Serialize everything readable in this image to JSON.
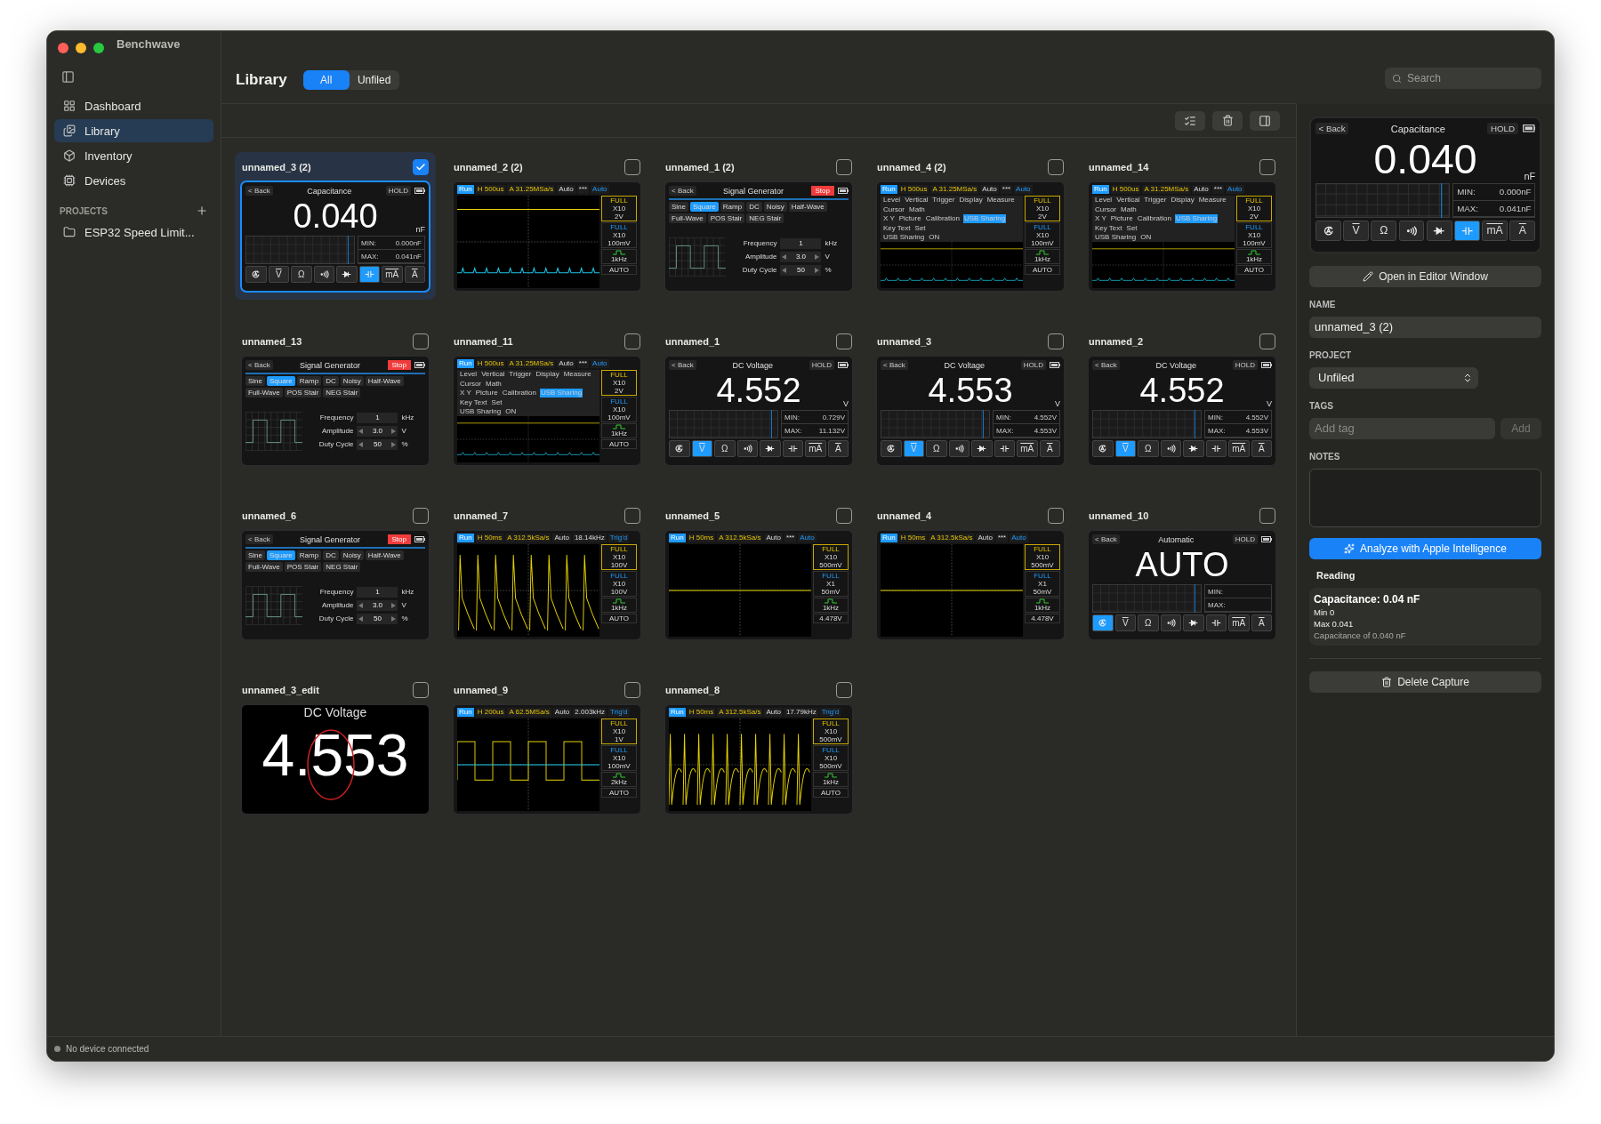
{
  "window": {
    "title": "Benchwave"
  },
  "sidebar": {
    "items": [
      {
        "label": "Dashboard",
        "selected": false
      },
      {
        "label": "Library",
        "selected": true
      },
      {
        "label": "Inventory",
        "selected": false
      },
      {
        "label": "Devices",
        "selected": false
      }
    ],
    "projects_heading": "PROJECTS",
    "projects": [
      {
        "label": "ESP32 Speed Limit..."
      }
    ]
  },
  "header": {
    "title": "Library",
    "filters": [
      {
        "label": "All",
        "selected": true
      },
      {
        "label": "Unfiled",
        "selected": false
      }
    ],
    "search": {
      "placeholder": "Search"
    }
  },
  "captures": [
    {
      "name": "unnamed_3 (2)",
      "selected": true,
      "screen": {
        "kind": "meter",
        "back": "< Back",
        "title": "Capacitance",
        "hold": "HOLD",
        "value": "0.040",
        "unit": "nF",
        "min_label": "MIN:",
        "min": "0.000nF",
        "max_label": "MAX:",
        "max": "0.041nF",
        "modes": [
          {
            "kind": "auto",
            "selected": false
          },
          {
            "kind": "dc",
            "label": "V",
            "selected": false
          },
          {
            "kind": "text",
            "label": "Ω",
            "selected": false
          },
          {
            "kind": "continuity",
            "selected": false
          },
          {
            "kind": "diode",
            "selected": false
          },
          {
            "kind": "cap",
            "selected": true
          },
          {
            "kind": "dc",
            "label": "mA",
            "selected": false
          },
          {
            "kind": "dc",
            "label": "A",
            "selected": false
          }
        ]
      }
    },
    {
      "name": "unnamed_2 (2)",
      "selected": false,
      "screen": {
        "kind": "scope",
        "run": "Run",
        "timebase": "H 500us",
        "rate": "A 31.25MSa/s",
        "trig": "Auto",
        "f_value": "***",
        "status": "Auto",
        "ch1": {
          "label": "FULL",
          "probe": "X10",
          "scale": "2V"
        },
        "ch2": {
          "label": "FULL",
          "probe": "X10",
          "scale": "100mV"
        },
        "fn": "1kHz",
        "mode": "AUTO",
        "trace": {
          "kind": "flat-high"
        }
      }
    },
    {
      "name": "unnamed_1 (2)",
      "selected": false,
      "screen": {
        "kind": "siggen",
        "back": "< Back",
        "title": "Signal Generator",
        "stop": "Stop",
        "waves": [
          {
            "label": "Sine",
            "selected": false
          },
          {
            "label": "Square",
            "selected": true
          },
          {
            "label": "Ramp",
            "selected": false
          },
          {
            "label": "DC",
            "selected": false
          },
          {
            "label": "Noisy",
            "selected": false
          },
          {
            "label": "Half-Wave",
            "selected": false
          },
          {
            "label": "Full-Wave",
            "selected": false
          },
          {
            "label": "POS Stair",
            "selected": false
          },
          {
            "label": "NEG Stair",
            "selected": false
          }
        ],
        "params": [
          {
            "label": "Frequency",
            "value": "1",
            "unit": "kHz",
            "stepper": false
          },
          {
            "label": "Amplitude",
            "value": "3.0",
            "unit": "V",
            "stepper": true
          },
          {
            "label": "Duty Cycle",
            "value": "50",
            "unit": "%",
            "stepper": true
          }
        ]
      }
    },
    {
      "name": "unnamed_4 (2)",
      "selected": false,
      "screen": {
        "kind": "scope",
        "run": "Run",
        "timebase": "H 500us",
        "rate": "A 31.25MSa/s",
        "trig": "Auto",
        "f_value": "***",
        "status": "Auto",
        "ch1": {
          "label": "FULL",
          "probe": "X10",
          "scale": "2V"
        },
        "ch2": {
          "label": "FULL",
          "probe": "X10",
          "scale": "100mV"
        },
        "fn": "1kHz",
        "mode": "AUTO",
        "trace": {
          "kind": "flat-high"
        },
        "menu": {
          "tabs": [
            "Level",
            "Vertical",
            "Trigger",
            "Display",
            "Measure",
            "Cursor",
            "Math"
          ],
          "options": [
            {
              "label": "X Y",
              "selected": false
            },
            {
              "label": "Picture",
              "selected": false
            },
            {
              "label": "Calibration",
              "selected": false
            },
            {
              "label": "USB Sharing",
              "selected": true
            },
            {
              "label": "Key Text",
              "selected": false
            },
            {
              "label": "Set",
              "selected": false
            }
          ],
          "setting": "USB Sharing",
          "setting_value": "ON"
        }
      }
    },
    {
      "name": "unnamed_14",
      "selected": false,
      "screen": {
        "kind": "scope",
        "run": "Run",
        "timebase": "H 500us",
        "rate": "A 31.25MSa/s",
        "trig": "Auto",
        "f_value": "***",
        "status": "Auto",
        "ch1": {
          "label": "FULL",
          "probe": "X10",
          "scale": "2V"
        },
        "ch2": {
          "label": "FULL",
          "probe": "X10",
          "scale": "100mV"
        },
        "fn": "1kHz",
        "mode": "AUTO",
        "trace": {
          "kind": "flat-high"
        },
        "menu": {
          "tabs": [
            "Level",
            "Vertical",
            "Trigger",
            "Display",
            "Measure",
            "Cursor",
            "Math"
          ],
          "options": [
            {
              "label": "X Y",
              "selected": false
            },
            {
              "label": "Picture",
              "selected": false
            },
            {
              "label": "Calibration",
              "selected": false
            },
            {
              "label": "USB Sharing",
              "selected": true
            },
            {
              "label": "Key Text",
              "selected": false
            },
            {
              "label": "Set",
              "selected": false
            }
          ],
          "setting": "USB Sharing",
          "setting_value": "ON"
        }
      }
    },
    {
      "name": "unnamed_13",
      "selected": false,
      "screen": {
        "kind": "siggen",
        "back": "< Back",
        "title": "Signal Generator",
        "stop": "Stop",
        "waves": [
          {
            "label": "Sine",
            "selected": false
          },
          {
            "label": "Square",
            "selected": true
          },
          {
            "label": "Ramp",
            "selected": false
          },
          {
            "label": "DC",
            "selected": false
          },
          {
            "label": "Noisy",
            "selected": false
          },
          {
            "label": "Half-Wave",
            "selected": false
          },
          {
            "label": "Full-Wave",
            "selected": false
          },
          {
            "label": "POS Stair",
            "selected": false
          },
          {
            "label": "NEG Stair",
            "selected": false
          }
        ],
        "params": [
          {
            "label": "Frequency",
            "value": "1",
            "unit": "kHz",
            "stepper": false
          },
          {
            "label": "Amplitude",
            "value": "3.0",
            "unit": "V",
            "stepper": true
          },
          {
            "label": "Duty Cycle",
            "value": "50",
            "unit": "%",
            "stepper": true
          }
        ]
      }
    },
    {
      "name": "unnamed_11",
      "selected": false,
      "screen": {
        "kind": "scope",
        "run": "Run",
        "timebase": "H 500us",
        "rate": "A 31.25MSa/s",
        "trig": "Auto",
        "f_value": "***",
        "status": "Auto",
        "ch1": {
          "label": "FULL",
          "probe": "X10",
          "scale": "2V"
        },
        "ch2": {
          "label": "FULL",
          "probe": "X10",
          "scale": "100mV"
        },
        "fn": "1kHz",
        "mode": "AUTO",
        "trace": {
          "kind": "flat-high"
        },
        "menu": {
          "tabs": [
            "Level",
            "Vertical",
            "Trigger",
            "Display",
            "Measure",
            "Cursor",
            "Math"
          ],
          "options": [
            {
              "label": "X Y",
              "selected": false
            },
            {
              "label": "Picture",
              "selected": false
            },
            {
              "label": "Calibration",
              "selected": false
            },
            {
              "label": "USB Sharing",
              "selected": true
            },
            {
              "label": "Key Text",
              "selected": false
            },
            {
              "label": "Set",
              "selected": false
            }
          ],
          "setting": "USB Sharing",
          "setting_value": "ON"
        }
      }
    },
    {
      "name": "unnamed_1",
      "selected": false,
      "screen": {
        "kind": "meter",
        "back": "< Back",
        "title": "DC Voltage",
        "hold": "HOLD",
        "value": "4.552",
        "unit": "V",
        "min_label": "MIN:",
        "min": "0.729V",
        "max_label": "MAX:",
        "max": "11.132V",
        "modes": [
          {
            "kind": "auto",
            "selected": false
          },
          {
            "kind": "dc",
            "label": "V",
            "selected": true
          },
          {
            "kind": "text",
            "label": "Ω",
            "selected": false
          },
          {
            "kind": "continuity",
            "selected": false
          },
          {
            "kind": "diode",
            "selected": false
          },
          {
            "kind": "cap",
            "selected": false
          },
          {
            "kind": "dc",
            "label": "mA",
            "selected": false
          },
          {
            "kind": "dc",
            "label": "A",
            "selected": false
          }
        ]
      }
    },
    {
      "name": "unnamed_3",
      "selected": false,
      "screen": {
        "kind": "meter",
        "back": "< Back",
        "title": "DC Voltage",
        "hold": "HOLD",
        "value": "4.553",
        "unit": "V",
        "min_label": "MIN:",
        "min": "4.552V",
        "max_label": "MAX:",
        "max": "4.553V",
        "modes": [
          {
            "kind": "auto",
            "selected": false
          },
          {
            "kind": "dc",
            "label": "V",
            "selected": true
          },
          {
            "kind": "text",
            "label": "Ω",
            "selected": false
          },
          {
            "kind": "continuity",
            "selected": false
          },
          {
            "kind": "diode",
            "selected": false
          },
          {
            "kind": "cap",
            "selected": false
          },
          {
            "kind": "dc",
            "label": "mA",
            "selected": false
          },
          {
            "kind": "dc",
            "label": "A",
            "selected": false
          }
        ]
      }
    },
    {
      "name": "unnamed_2",
      "selected": false,
      "screen": {
        "kind": "meter",
        "back": "< Back",
        "title": "DC Voltage",
        "hold": "HOLD",
        "value": "4.552",
        "unit": "V",
        "min_label": "MIN:",
        "min": "4.552V",
        "max_label": "MAX:",
        "max": "4.553V",
        "modes": [
          {
            "kind": "auto",
            "selected": false
          },
          {
            "kind": "dc",
            "label": "V",
            "selected": true
          },
          {
            "kind": "text",
            "label": "Ω",
            "selected": false
          },
          {
            "kind": "continuity",
            "selected": false
          },
          {
            "kind": "diode",
            "selected": false
          },
          {
            "kind": "cap",
            "selected": false
          },
          {
            "kind": "dc",
            "label": "mA",
            "selected": false
          },
          {
            "kind": "dc",
            "label": "A",
            "selected": false
          }
        ]
      }
    },
    {
      "name": "unnamed_6",
      "selected": false,
      "screen": {
        "kind": "siggen",
        "back": "< Back",
        "title": "Signal Generator",
        "stop": "Stop",
        "waves": [
          {
            "label": "Sine",
            "selected": false
          },
          {
            "label": "Square",
            "selected": true
          },
          {
            "label": "Ramp",
            "selected": false
          },
          {
            "label": "DC",
            "selected": false
          },
          {
            "label": "Noisy",
            "selected": false
          },
          {
            "label": "Half-Wave",
            "selected": false
          },
          {
            "label": "Full-Wave",
            "selected": false
          },
          {
            "label": "POS Stair",
            "selected": false
          },
          {
            "label": "NEG Stair",
            "selected": false
          }
        ],
        "params": [
          {
            "label": "Frequency",
            "value": "1",
            "unit": "kHz",
            "stepper": false
          },
          {
            "label": "Amplitude",
            "value": "3.0",
            "unit": "V",
            "stepper": true
          },
          {
            "label": "Duty Cycle",
            "value": "50",
            "unit": "%",
            "stepper": true
          }
        ]
      }
    },
    {
      "name": "unnamed_7",
      "selected": false,
      "screen": {
        "kind": "scope",
        "run": "Run",
        "timebase": "H 50ms",
        "rate": "A 312.5kSa/s",
        "trig": "Auto",
        "f_value": "18.14kHz",
        "status": "Trig'd",
        "ch1": {
          "label": "FULL",
          "probe": "X10",
          "scale": "100V"
        },
        "ch2": {
          "label": "FULL",
          "probe": "X10",
          "scale": "100V"
        },
        "fn": "1kHz",
        "mode": "AUTO",
        "trace": {
          "kind": "pulses"
        }
      }
    },
    {
      "name": "unnamed_5",
      "selected": false,
      "screen": {
        "kind": "scope",
        "run": "Run",
        "timebase": "H 50ms",
        "rate": "A 312.5kSa/s",
        "trig": "Auto",
        "f_value": "***",
        "status": "Auto",
        "ch1": {
          "label": "FULL",
          "probe": "X10",
          "scale": "500mV"
        },
        "ch2": {
          "label": "FULL",
          "probe": "X1",
          "scale": "50mV"
        },
        "fn": "1kHz",
        "mode": "4.478V",
        "trace": {
          "kind": "flat-mid"
        }
      }
    },
    {
      "name": "unnamed_4",
      "selected": false,
      "screen": {
        "kind": "scope",
        "run": "Run",
        "timebase": "H 50ms",
        "rate": "A 312.5kSa/s",
        "trig": "Auto",
        "f_value": "***",
        "status": "Auto",
        "ch1": {
          "label": "FULL",
          "probe": "X10",
          "scale": "500mV"
        },
        "ch2": {
          "label": "FULL",
          "probe": "X1",
          "scale": "50mV"
        },
        "fn": "1kHz",
        "mode": "4.478V",
        "trace": {
          "kind": "flat-mid"
        }
      }
    },
    {
      "name": "unnamed_10",
      "selected": false,
      "screen": {
        "kind": "meter",
        "back": "< Back",
        "title": "Automatic",
        "hold": "HOLD",
        "value": "AUTO",
        "min_label": "MIN:",
        "max_label": "MAX:",
        "modes": [
          {
            "kind": "auto",
            "selected": true
          },
          {
            "kind": "dc",
            "label": "V",
            "selected": false
          },
          {
            "kind": "text",
            "label": "Ω",
            "selected": false
          },
          {
            "kind": "continuity",
            "selected": false
          },
          {
            "kind": "diode",
            "selected": false
          },
          {
            "kind": "cap",
            "selected": false
          },
          {
            "kind": "dc",
            "label": "mA",
            "selected": false
          },
          {
            "kind": "dc",
            "label": "A",
            "selected": false
          }
        ]
      }
    },
    {
      "name": "unnamed_3_edit",
      "selected": false,
      "screen": {
        "kind": "zoomed",
        "title": "DC Voltage",
        "value": "4.553",
        "annotated": true
      }
    },
    {
      "name": "unnamed_9",
      "selected": false,
      "screen": {
        "kind": "scope",
        "run": "Run",
        "timebase": "H 200us",
        "rate": "A 62.5MSa/s",
        "trig": "Auto",
        "f_value": "2.003kHz",
        "status": "Trig'd",
        "ch1": {
          "label": "FULL",
          "probe": "X10",
          "scale": "1V"
        },
        "ch2": {
          "label": "FULL",
          "probe": "X10",
          "scale": "100mV"
        },
        "fn": "2kHz",
        "mode": "AUTO",
        "trace": {
          "kind": "square"
        }
      }
    },
    {
      "name": "unnamed_8",
      "selected": false,
      "screen": {
        "kind": "scope",
        "run": "Run",
        "timebase": "H 50ms",
        "rate": "A 312.5kSa/s",
        "trig": "Auto",
        "f_value": "17.79kHz",
        "status": "Trig'd",
        "ch1": {
          "label": "FULL",
          "probe": "X10",
          "scale": "500mV"
        },
        "ch2": {
          "label": "FULL",
          "probe": "X10",
          "scale": "500mV"
        },
        "fn": "1kHz",
        "mode": "AUTO",
        "trace": {
          "kind": "spikes"
        }
      }
    }
  ],
  "inspector": {
    "preview": {
      "kind": "meter",
      "back": "< Back",
      "title": "Capacitance",
      "hold": "HOLD",
      "value": "0.040",
      "unit": "nF",
      "min_label": "MIN:",
      "min": "0.000nF",
      "max_label": "MAX:",
      "max": "0.041nF",
      "modes": [
        {
          "kind": "auto",
          "selected": false
        },
        {
          "kind": "dc",
          "label": "V",
          "selected": false
        },
        {
          "kind": "text",
          "label": "Ω",
          "selected": false
        },
        {
          "kind": "continuity",
          "selected": false
        },
        {
          "kind": "diode",
          "selected": false
        },
        {
          "kind": "cap",
          "selected": true
        },
        {
          "kind": "dc",
          "label": "mA",
          "selected": false
        },
        {
          "kind": "dc",
          "label": "A",
          "selected": false
        }
      ]
    },
    "open_editor": "Open in Editor Window",
    "name_label": "NAME",
    "name": "unnamed_3 (2)",
    "project_label": "PROJECT",
    "project": "Unfiled",
    "tags_label": "TAGS",
    "tag_placeholder": "Add tag",
    "add": "Add",
    "add_disabled": true,
    "notes_label": "NOTES",
    "analyze": "Analyze with Apple Intelligence",
    "reading": {
      "heading": "Reading",
      "title": "Capacitance: 0.04 nF",
      "lines": [
        "Min 0",
        "Max 0.041"
      ],
      "summary": "Capacitance of 0.040 nF"
    },
    "delete": "Delete Capture"
  },
  "status_bar": {
    "text": "No device connected",
    "connected": false
  }
}
